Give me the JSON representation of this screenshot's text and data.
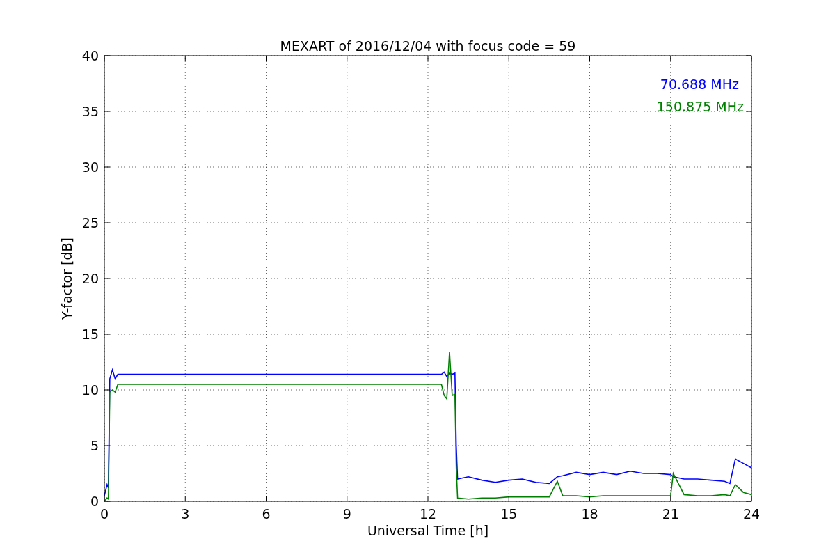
{
  "figure": {
    "chart_data": {
      "type": "line",
      "title": "MEXART of 2016/12/04 with focus code = 59",
      "xlabel": "Universal Time [h]",
      "ylabel": "Y-factor [dB]",
      "x": [
        0,
        0.1,
        0.15,
        0.2,
        0.3,
        0.4,
        0.5,
        1,
        3,
        6,
        9,
        12,
        12.5,
        12.6,
        12.7,
        12.8,
        12.9,
        13,
        13.05,
        13.1,
        13.5,
        14,
        14.5,
        15,
        15.5,
        16,
        16.5,
        16.8,
        17,
        17.5,
        18,
        18.5,
        19,
        19.5,
        20,
        20.5,
        21,
        21.1,
        21.5,
        22,
        22.5,
        23,
        23.2,
        23.4,
        23.7,
        24
      ],
      "series": [
        {
          "name": "70.688 MHz",
          "color": "#0000ff",
          "values": [
            0.5,
            1.5,
            1.2,
            11,
            11.8,
            11,
            11.4,
            11.4,
            11.4,
            11.4,
            11.4,
            11.4,
            11.4,
            11.6,
            11.2,
            11.5,
            11.4,
            11.5,
            5,
            2,
            2.2,
            1.9,
            1.7,
            1.9,
            2,
            1.7,
            1.6,
            2.2,
            2.3,
            2.6,
            2.4,
            2.6,
            2.4,
            2.7,
            2.5,
            2.5,
            2.4,
            2.2,
            2,
            2,
            1.9,
            1.8,
            1.6,
            3.8,
            3.4,
            3
          ]
        },
        {
          "name": "150.875 MHz",
          "color": "#008000",
          "values": [
            0,
            0.3,
            0.2,
            9.8,
            10,
            9.8,
            10.5,
            10.5,
            10.5,
            10.5,
            10.5,
            10.5,
            10.5,
            9.5,
            9.2,
            13.4,
            9.5,
            9.6,
            3,
            0.3,
            0.2,
            0.3,
            0.3,
            0.4,
            0.4,
            0.4,
            0.4,
            1.8,
            0.5,
            0.5,
            0.4,
            0.5,
            0.5,
            0.5,
            0.5,
            0.5,
            0.5,
            2.5,
            0.6,
            0.5,
            0.5,
            0.6,
            0.5,
            1.5,
            0.8,
            0.6
          ]
        }
      ],
      "xlim": [
        0,
        24
      ],
      "ylim": [
        0,
        40
      ],
      "xticks": [
        0,
        3,
        6,
        9,
        12,
        15,
        18,
        21,
        24
      ],
      "yticks": [
        0,
        5,
        10,
        15,
        20,
        25,
        30,
        35,
        40
      ],
      "grid": true
    }
  }
}
